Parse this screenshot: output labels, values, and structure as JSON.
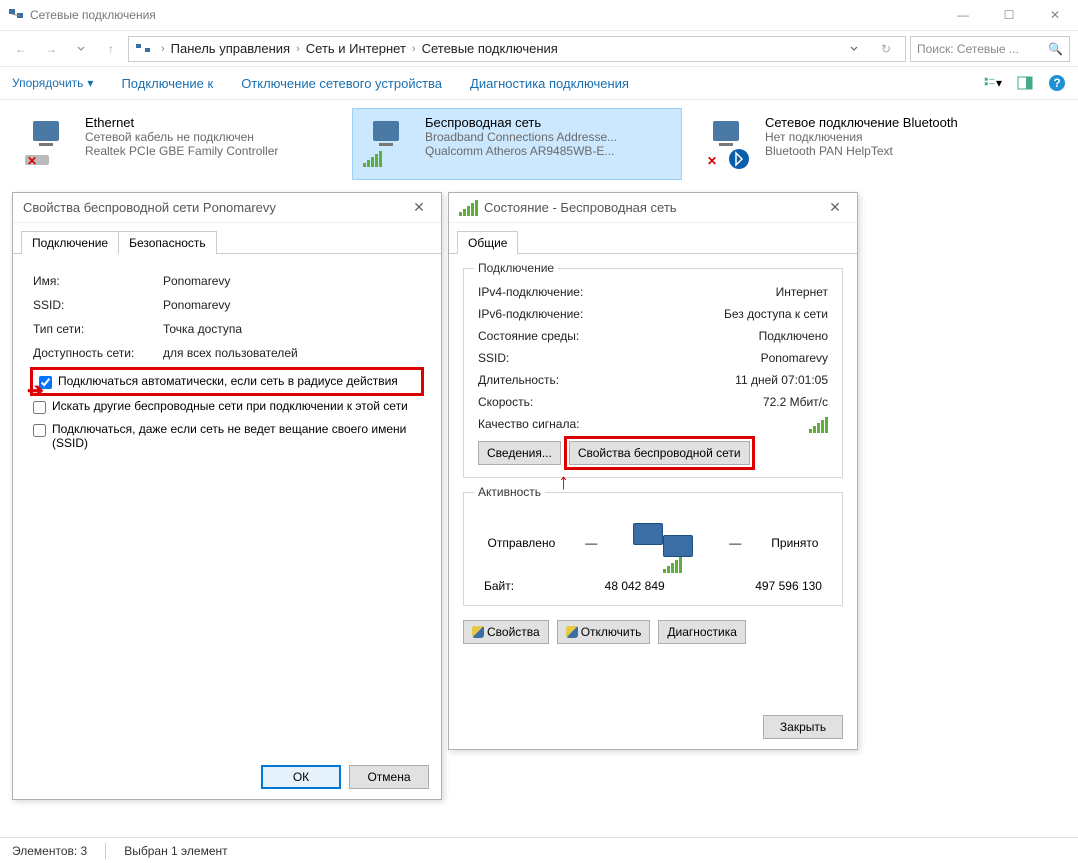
{
  "window": {
    "title": "Сетевые подключения",
    "min": "—",
    "max": "☐",
    "close": "✕"
  },
  "address": {
    "crumbs": [
      "Панель управления",
      "Сеть и Интернет",
      "Сетевые подключения"
    ],
    "search_placeholder": "Поиск: Сетевые ..."
  },
  "toolbar": {
    "organize": "Упорядочить",
    "connect": "Подключение к",
    "disable": "Отключение сетевого устройства",
    "diag": "Диагностика подключения"
  },
  "tiles": [
    {
      "title": "Ethernet",
      "sub1": "Сетевой кабель не подключен",
      "sub2": "Realtek PCIe GBE Family Controller"
    },
    {
      "title": "Беспроводная сеть",
      "sub1": "Broadband Connections Addresse...",
      "sub2": "Qualcomm Atheros AR9485WB-E..."
    },
    {
      "title": "Сетевое подключение Bluetooth",
      "sub1": "Нет подключения",
      "sub2": "Bluetooth PAN HelpText"
    }
  ],
  "props": {
    "title": "Свойства беспроводной сети Ponomarevy",
    "tabs": {
      "conn": "Подключение",
      "sec": "Безопасность"
    },
    "labels": {
      "name": "Имя:",
      "ssid": "SSID:",
      "type": "Тип сети:",
      "avail": "Доступность сети:"
    },
    "values": {
      "name": "Ponomarevy",
      "ssid": "Ponomarevy",
      "type": "Точка доступа",
      "avail": "для всех пользователей"
    },
    "check": {
      "auto": "Подключаться автоматически, если сеть в радиусе действия",
      "other": "Искать другие беспроводные сети при подключении к этой сети",
      "hidden": "Подключаться, даже если сеть не ведет вещание своего имени (SSID)"
    },
    "ok": "ОК",
    "cancel": "Отмена"
  },
  "status": {
    "title": "Состояние - Беспроводная сеть",
    "tab": "Общие",
    "conn_legend": "Подключение",
    "rows": {
      "ipv4_l": "IPv4-подключение:",
      "ipv4_v": "Интернет",
      "ipv6_l": "IPv6-подключение:",
      "ipv6_v": "Без доступа к сети",
      "state_l": "Состояние среды:",
      "state_v": "Подключено",
      "ssid_l": "SSID:",
      "ssid_v": "Ponomarevy",
      "dur_l": "Длительность:",
      "dur_v": "11 дней 07:01:05",
      "speed_l": "Скорость:",
      "speed_v": "72.2 Мбит/с",
      "sig_l": "Качество сигнала:"
    },
    "btn_details": "Сведения...",
    "btn_wprops": "Свойства беспроводной сети",
    "act_legend": "Активность",
    "sent": "Отправлено",
    "sent_divider": "—",
    "recv": "Принято",
    "bytes_l": "Байт:",
    "bytes_sent": "48 042 849",
    "bytes_recv": "497 596 130",
    "btn_props": "Свойства",
    "btn_disable": "Отключить",
    "btn_diag": "Диагностика",
    "btn_close": "Закрыть"
  },
  "statusbar": {
    "count": "Элементов: 3",
    "sel": "Выбран 1 элемент"
  }
}
